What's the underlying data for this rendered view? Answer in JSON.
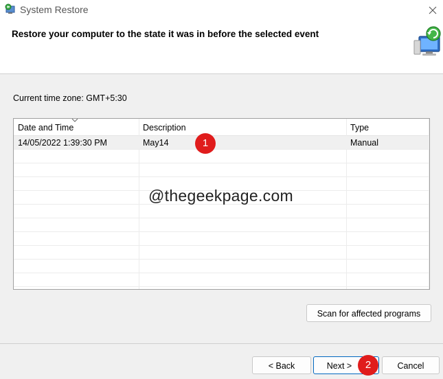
{
  "window": {
    "title": "System Restore"
  },
  "header": {
    "heading": "Restore your computer to the state it was in before the selected event"
  },
  "timezone": {
    "label": "Current time zone: GMT+5:30"
  },
  "table": {
    "columns": [
      "Date and Time",
      "Description",
      "Type"
    ],
    "rows": [
      {
        "date": "14/05/2022 1:39:30 PM",
        "description": "May14",
        "type": "Manual"
      }
    ]
  },
  "watermark": "@thegeekpage.com",
  "badges": [
    "1",
    "2"
  ],
  "buttons": {
    "scan": "Scan for affected programs",
    "back": "< Back",
    "next": "Next >",
    "cancel": "Cancel"
  },
  "colors": {
    "badge": "#e01c1c",
    "background": "#f0f0f0"
  }
}
